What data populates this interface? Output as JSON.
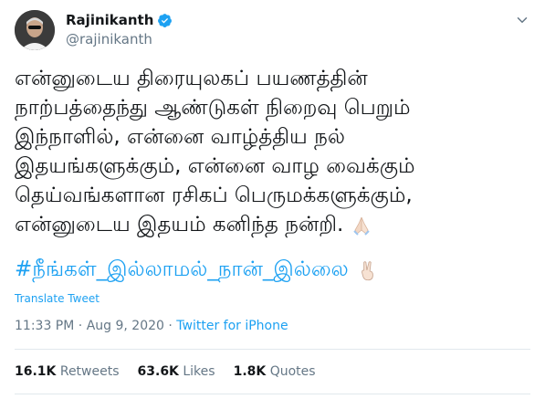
{
  "user": {
    "name": "Rajinikanth",
    "handle": "@rajinikanth"
  },
  "tweet": {
    "lines": [
      "என்னுடைய திரையுலகப் பயணத்தின்",
      "நாற்பத்தைந்து ஆண்டுகள் நிறைவு பெறும்",
      "இந்நாளில், என்னை வாழ்த்திய நல்",
      "இதயங்களுக்கும், என்னை வாழ வைக்கும்",
      "தெய்வங்களான ரசிகப் பெருமக்களுக்கும்,",
      "என்னுடைய இதயம் கனிந்த நன்றி."
    ],
    "hashtag": "#நீங்கள்_இல்லாமல்_நான்_இல்லை"
  },
  "translate_label": "Translate Tweet",
  "meta": {
    "time": "11:33 PM",
    "separator": " · ",
    "date": "Aug 9, 2020",
    "separator2": " · ",
    "source": "Twitter for iPhone"
  },
  "stats": {
    "retweets_count": "16.1K",
    "retweets_label": "Retweets",
    "likes_count": "63.6K",
    "likes_label": "Likes",
    "quotes_count": "1.8K",
    "quotes_label": "Quotes"
  },
  "colors": {
    "accent": "#1da1f2",
    "muted": "#657786",
    "text": "#14171a",
    "divider": "#e1e8ed"
  },
  "icons": [
    "verified-badge-icon",
    "chevron-down-icon",
    "folded-hands-emoji-icon",
    "victory-hand-emoji-icon"
  ]
}
